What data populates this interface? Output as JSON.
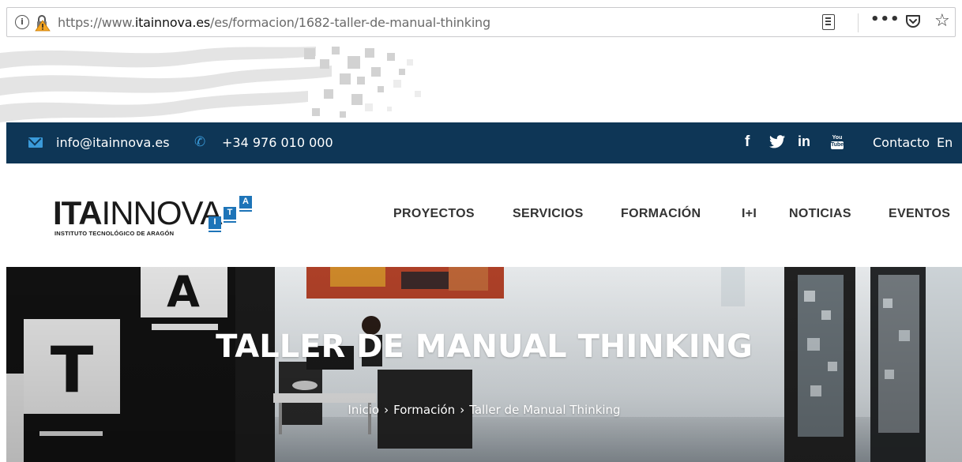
{
  "browser": {
    "url_prefix": "https://www.",
    "url_host": "itainnova.es",
    "url_path": "/es/formacion/1682-taller-de-manual-thinking",
    "info_glyph": "i",
    "more_glyph": "•••",
    "star_glyph": "☆",
    "icons": [
      "info-icon",
      "insecure-lock-icon",
      "reader-view-icon",
      "more-icon",
      "pocket-icon",
      "bookmark-star-icon"
    ]
  },
  "contact_bar": {
    "email": "info@itainnova.es",
    "phone": "+34 976 010 000",
    "phone_glyph": "✆",
    "social": {
      "facebook": "f",
      "linkedin": "in",
      "youtube_top": "You",
      "youtube_bottom": "Tube"
    },
    "contact_link": "Contacto",
    "language_link": "En",
    "colors": {
      "background": "#0e3656",
      "accent": "#3a9ad9"
    }
  },
  "logo": {
    "bold_part": "ITA",
    "light_part": "INNOVA",
    "subtitle": "INSTITUTO TECNOLÓGICO DE ARAGÓN",
    "blocks": [
      "I",
      "T",
      "A"
    ],
    "accent_color": "#1d74b8"
  },
  "nav": {
    "items": [
      "PROYECTOS",
      "SERVICIOS",
      "FORMACIÓN",
      "I+I",
      "NOTICIAS",
      "EVENTOS"
    ]
  },
  "hero": {
    "title": "TALLER DE MANUAL THINKING",
    "breadcrumb": [
      "Inicio",
      "Formación",
      "Taller de Manual Thinking"
    ],
    "breadcrumb_separator": "›",
    "wall_letters": [
      "A",
      "T"
    ]
  }
}
